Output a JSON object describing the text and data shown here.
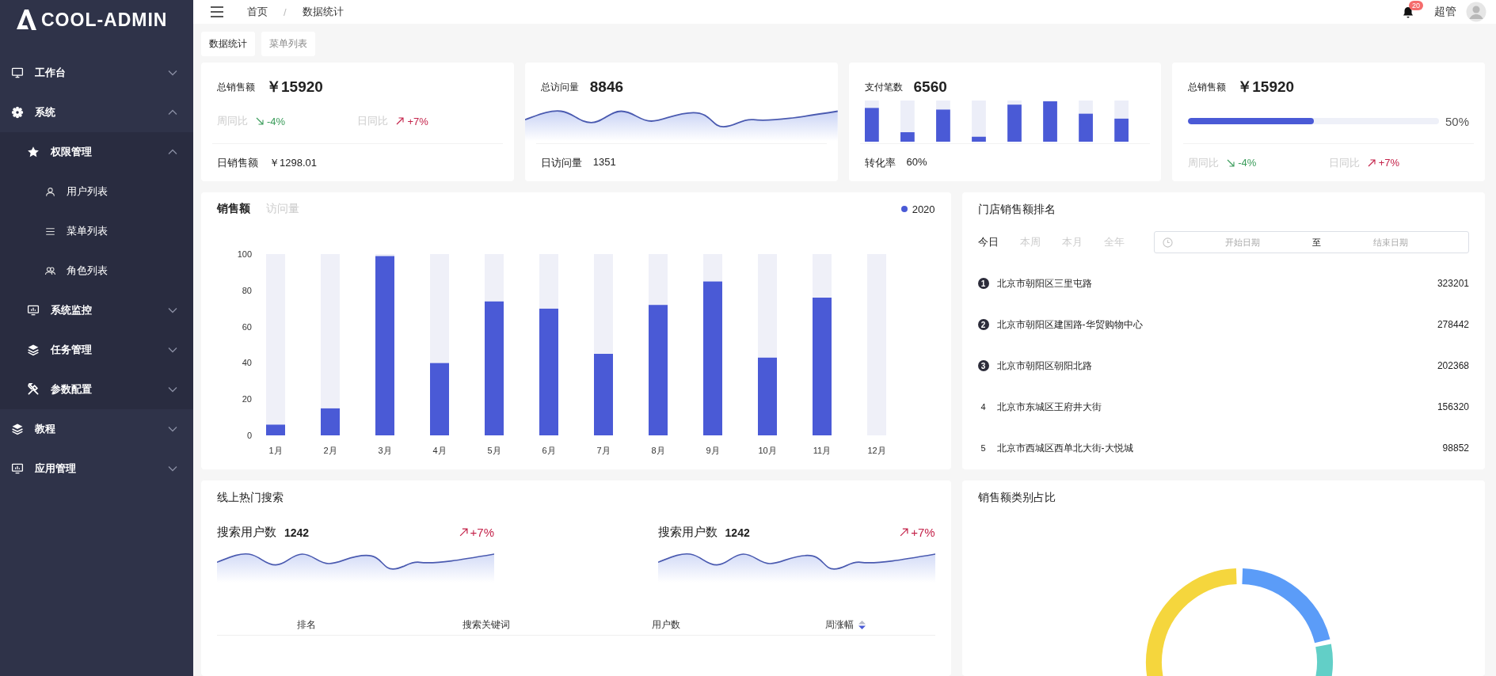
{
  "logo": {
    "text": "COOL-ADMIN"
  },
  "sidebar": {
    "items": [
      {
        "label": "工作台",
        "expanded": false
      },
      {
        "label": "系统",
        "expanded": true,
        "children": [
          {
            "label": "权限管理",
            "expanded": true,
            "children": [
              {
                "label": "用户列表"
              },
              {
                "label": "菜单列表"
              },
              {
                "label": "角色列表"
              }
            ]
          },
          {
            "label": "系统监控",
            "expanded": false
          },
          {
            "label": "任务管理",
            "expanded": false
          },
          {
            "label": "参数配置",
            "expanded": false
          }
        ]
      },
      {
        "label": "教程",
        "expanded": false
      },
      {
        "label": "应用管理",
        "expanded": false
      }
    ]
  },
  "header": {
    "breadcrumb": [
      "首页",
      "数据统计"
    ],
    "separator": "/",
    "notifications": "20",
    "user": "超管"
  },
  "tabs": [
    {
      "label": "数据统计",
      "selected": true
    },
    {
      "label": "菜单列表",
      "selected": false
    }
  ],
  "cards": [
    {
      "kind": "compare",
      "title": "总销售额",
      "value": "￥15920",
      "compares": [
        {
          "label": "周同比",
          "value": "-4%",
          "rising": false
        },
        {
          "label": "日同比",
          "value": "+7%",
          "rising": true
        }
      ],
      "footer": {
        "label": "日销售额",
        "value": "￥1298.01"
      }
    },
    {
      "kind": "sparkline",
      "title": "总访问量",
      "value": "8846",
      "footer": {
        "label": "日访问量",
        "value": "1351"
      }
    },
    {
      "kind": "bars",
      "title": "支付笔数",
      "value": "6560",
      "footer": {
        "label": "转化率",
        "value": "60%"
      }
    },
    {
      "kind": "progress",
      "title": "总销售额",
      "value": "￥15920",
      "progress": {
        "level": 0.5,
        "reading": "50%"
      },
      "compares": [
        {
          "label": "周同比",
          "value": "-4%",
          "rising": false
        },
        {
          "label": "日同比",
          "value": "+7%",
          "rising": true
        }
      ]
    }
  ],
  "sales_panel": {
    "tabs": [
      {
        "label": "销售额",
        "selected": true
      },
      {
        "label": "访问量",
        "selected": false
      }
    ],
    "chart_data": {
      "type": "bar",
      "categories": [
        "1月",
        "2月",
        "3月",
        "4月",
        "5月",
        "6月",
        "7月",
        "8月",
        "9月",
        "10月",
        "11月",
        "12月"
      ],
      "series": [
        {
          "name": "2020",
          "color": "#4a5ad6",
          "values": [
            6,
            15,
            99,
            40,
            74,
            70,
            45,
            72,
            85,
            43,
            76,
            0
          ]
        },
        {
          "color": "#eff0f8",
          "values": [
            94,
            85,
            1,
            60,
            26,
            30,
            55,
            28,
            15,
            57,
            24,
            100
          ]
        }
      ],
      "stacked": true,
      "ylim": [
        0,
        100
      ],
      "yticks": [
        0,
        20,
        40,
        60,
        80,
        100
      ]
    }
  },
  "ranking": {
    "title": "门店销售额排名",
    "periods": [
      {
        "label": "今日",
        "selected": true
      },
      {
        "label": "本周",
        "selected": false
      },
      {
        "label": "本月",
        "selected": false
      },
      {
        "label": "全年",
        "selected": false
      }
    ],
    "date_range": {
      "start_placeholder": "开始日期",
      "separator": "至",
      "end_placeholder": "结束日期"
    },
    "rows": [
      {
        "rank": "1",
        "name": "北京市朝阳区三里屯路",
        "value": "323201"
      },
      {
        "rank": "2",
        "name": "北京市朝阳区建国路-华贸购物中心",
        "value": "278442"
      },
      {
        "rank": "3",
        "name": "北京市朝阳区朝阳北路",
        "value": "202368"
      },
      {
        "rank": "4",
        "name": "北京市东城区王府井大街",
        "value": "156320"
      },
      {
        "rank": "5",
        "name": "北京市西城区西单北大街-大悦城",
        "value": "98852"
      }
    ]
  },
  "hot_search": {
    "title": "线上热门搜索",
    "stats": [
      {
        "label": "搜索用户数",
        "value": "1242",
        "change": "+7%",
        "rising": true
      },
      {
        "label": "搜索用户数",
        "value": "1242",
        "change": "+7%",
        "rising": true
      }
    ],
    "table": {
      "columns": [
        "排名",
        "搜索关键词",
        "用户数",
        "周涨幅"
      ]
    }
  },
  "category_share": {
    "title": "销售额类别占比"
  }
}
